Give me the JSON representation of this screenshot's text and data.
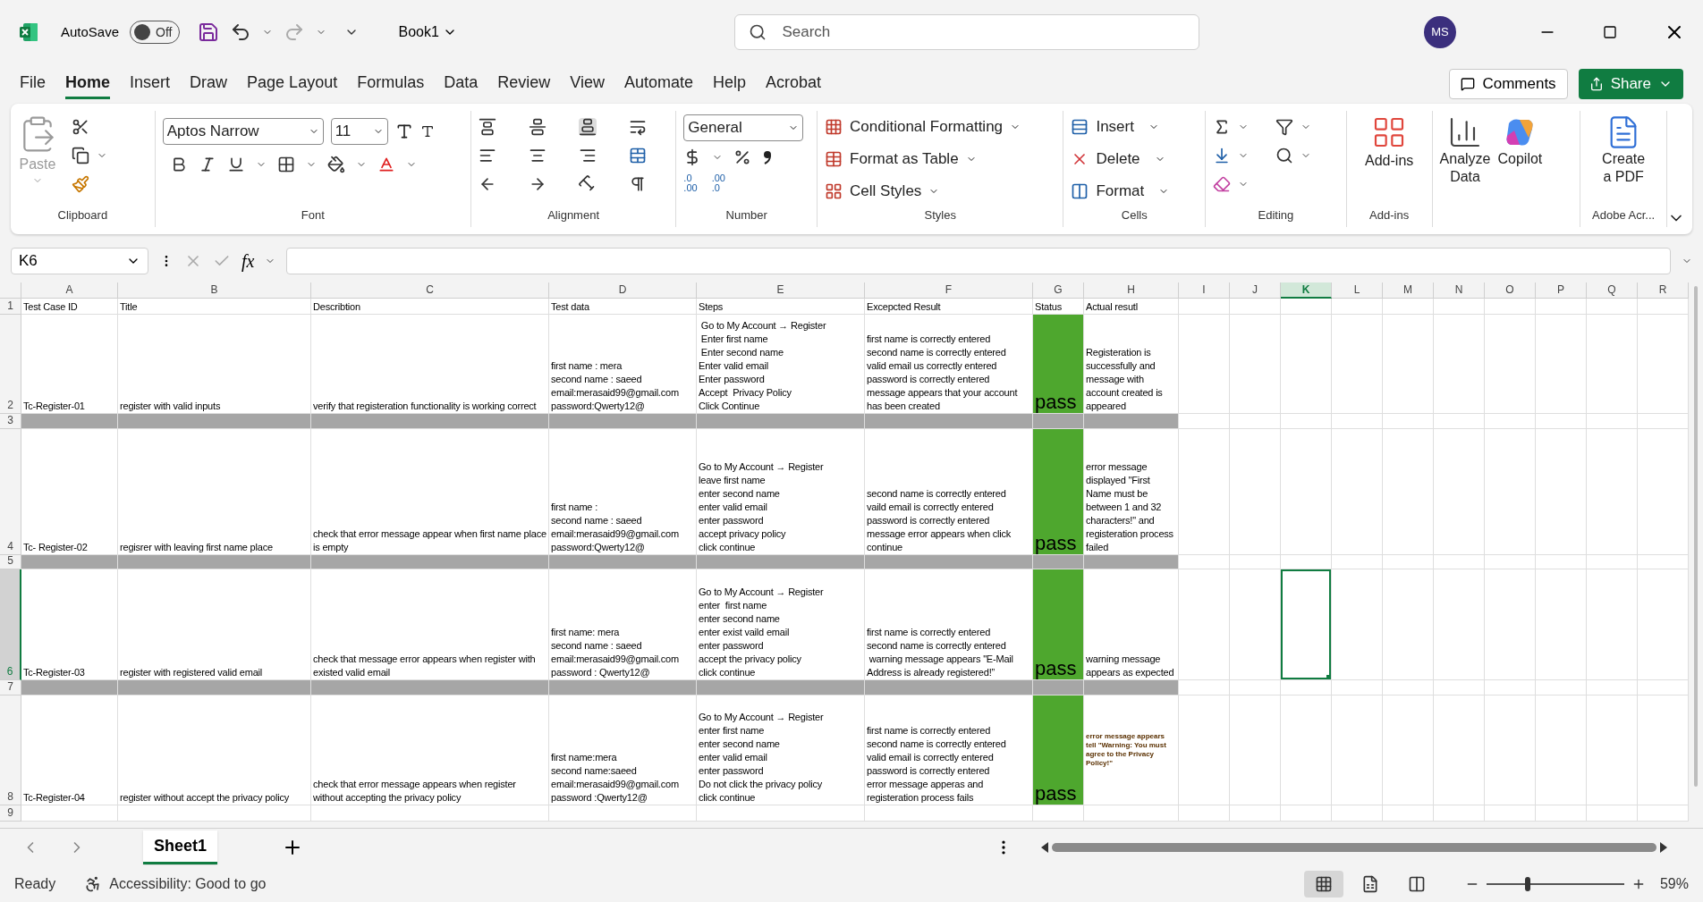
{
  "title_bar": {
    "autosave_label": "AutoSave",
    "autosave": {
      "on": false,
      "label": "Off"
    },
    "document": "Book1",
    "search": {
      "placeholder": "Search"
    },
    "avatar": "MS"
  },
  "menu_tabs": [
    {
      "label": "File",
      "selected": false
    },
    {
      "label": "Home",
      "selected": true
    },
    {
      "label": "Insert",
      "selected": false
    },
    {
      "label": "Draw",
      "selected": false
    },
    {
      "label": "Page Layout",
      "selected": false
    },
    {
      "label": "Formulas",
      "selected": false
    },
    {
      "label": "Data",
      "selected": false
    },
    {
      "label": "Review",
      "selected": false
    },
    {
      "label": "View",
      "selected": false
    },
    {
      "label": "Automate",
      "selected": false
    },
    {
      "label": "Help",
      "selected": false
    },
    {
      "label": "Acrobat",
      "selected": false
    }
  ],
  "comments_button": "Comments",
  "share_button": "Share",
  "ribbon": {
    "clipboard": {
      "paste": {
        "label": "Paste",
        "disabled": true
      },
      "label": "Clipboard"
    },
    "font": {
      "name": "Aptos Narrow",
      "size": "11",
      "label": "Font"
    },
    "alignment": {
      "label": "Alignment"
    },
    "number": {
      "format": "General",
      "decimal_buttons": [
        {
          "top": ".0",
          "bottom": ".00"
        },
        {
          "top": ".00",
          "bottom": ".0"
        }
      ],
      "label": "Number"
    },
    "styles": {
      "buttons": [
        "Conditional Formatting",
        "Format as Table",
        "Cell Styles"
      ],
      "label": "Styles"
    },
    "cells": {
      "buttons": [
        "Insert",
        "Delete",
        "Format"
      ],
      "label": "Cells"
    },
    "editing": {
      "label": "Editing"
    },
    "add_ins": {
      "button": "Add-ins",
      "label": "Add-ins"
    },
    "analyze_data": "Analyze\nData",
    "copilot": "Copilot",
    "adobe": {
      "button": "Create\na PDF",
      "label": "Adobe Acr..."
    }
  },
  "formula_bar": {
    "name_box": "K6",
    "function_label": "fx"
  },
  "columns": [
    {
      "label": "A",
      "selected": false
    },
    {
      "label": "B",
      "selected": false
    },
    {
      "label": "C",
      "selected": false
    },
    {
      "label": "D",
      "selected": false
    },
    {
      "label": "E",
      "selected": false
    },
    {
      "label": "F",
      "selected": false
    },
    {
      "label": "G",
      "selected": false
    },
    {
      "label": "H",
      "selected": false
    },
    {
      "label": "I",
      "selected": false
    },
    {
      "label": "J",
      "selected": false
    },
    {
      "label": "K",
      "selected": true
    },
    {
      "label": "L",
      "selected": false
    },
    {
      "label": "M",
      "selected": false
    },
    {
      "label": "N",
      "selected": false
    },
    {
      "label": "O",
      "selected": false
    },
    {
      "label": "P",
      "selected": false
    },
    {
      "label": "Q",
      "selected": false
    },
    {
      "label": "R",
      "selected": false
    }
  ],
  "rows": [
    {
      "number": "1",
      "kind": "header",
      "selected": false,
      "cells": [
        "Test Case ID",
        "Title",
        "Describtion",
        "Test data",
        "Steps",
        "Excepcted Result",
        "Status",
        "Actual resutl"
      ]
    },
    {
      "number": "2",
      "kind": "case",
      "selected": false,
      "test_case_id": "Tc-Register-01",
      "title": "register with valid inputs",
      "description": "verify that registeration functionality is working correct",
      "test_data": "first name : mera\nsecond name : saeed\nemail:merasaid99@gmail.com\npassword:Qwerty12@",
      "steps": " Go to My Account → Register\n Enter first name\n Enter second name\nEnter valid email\nEnter password\nAccept  Privacy Policy\nClick Continue",
      "expected_result": "first name is correctly entered\nsecond name is correctly entered\nvalid email us correctly entered\npassword is correctly entered\nmessage appears that your account\nhas been created",
      "status": {
        "text": "pass",
        "kind": "pass"
      },
      "actual_result": {
        "text": "Registeration is successfully and message with account created is appeared",
        "kind": "normal"
      }
    },
    {
      "number": "3",
      "kind": "separator",
      "selected": false
    },
    {
      "number": "4",
      "kind": "case",
      "selected": false,
      "test_case_id": "Tc- Register-02",
      "title": "regisrer with leaving first name place",
      "description": "check that error message appear when first name place is empty",
      "test_data": "first name :\nsecond name : saeed\nemail:merasaid99@gmail.com\npassword:Qwerty12@",
      "steps": "Go to My Account → Register\nleave first name\nenter second name\nenter valid email\nenter password\naccept privacy policy\nclick continue",
      "expected_result": "second name is correctly entered\nvaild email is correctly entered\npassword is correctly entered\nmessage error appears when click\ncontinue",
      "status": {
        "text": "pass",
        "kind": "pass"
      },
      "actual_result": {
        "text": "error message displayed \"First Name must be between 1 and 32 characters!\" and registeration process failed",
        "kind": "normal"
      }
    },
    {
      "number": "5",
      "kind": "separator",
      "selected": false
    },
    {
      "number": "6",
      "kind": "case",
      "selected": true,
      "test_case_id": "Tc-Register-03",
      "title": "register with registered valid email",
      "description": "check that message error appears when register with existed valid email",
      "test_data": "first name: mera\nsecond name : saeed\nemail:merasaid99@gmail.com\npassword : Qwerty12@",
      "steps": "Go to My Account → Register\nenter  first name\nenter second name\nenter exist vaild email\nenter password\naccept the privacy policy\nclick continue",
      "expected_result": "first name is correctly entered\nsecond name is correctly entered\n warning message appears \"E-Mail\nAddress is already registered!”",
      "status": {
        "text": "pass",
        "kind": "pass"
      },
      "actual_result": {
        "text": "warning message appears as expected",
        "kind": "normal"
      }
    },
    {
      "number": "7",
      "kind": "separator",
      "selected": false
    },
    {
      "number": "8",
      "kind": "case",
      "selected": false,
      "test_case_id": "Tc-Register-04",
      "title": "register without accept the privacy policy",
      "description": "check that error message appears when register without accepting the privacy policy",
      "test_data": "first name:mera\nsecond name:saeed\nemail:merasaid99@gmail.com\npassword :Qwerty12@",
      "steps": "Go to My Account → Register\nenter first name\nenter second name\nenter valid email\nenter password\nDo not click the privacy policy\nclick continue",
      "expected_result": "first name is correctly entered\nsecond name is correctly entered\nvalid email is correctly entered\npassword is correctly entered\nerror message apperas and\nregisteration process fails",
      "status": {
        "text": "pass",
        "kind": "pass"
      },
      "actual_result": {
        "text": "error message appears tell \"Warning: You must agree to the Privacy Policy!\"",
        "kind": "fine_print"
      }
    },
    {
      "number": "9",
      "kind": "empty",
      "selected": false
    }
  ],
  "sheet_tabs": [
    {
      "label": "Sheet1",
      "selected": true
    }
  ],
  "status_bar": {
    "ready": "Ready",
    "accessibility": "Accessibility: Good to go",
    "views": [
      {
        "kind": "normal",
        "selected": true
      },
      {
        "kind": "page_layout",
        "selected": false
      },
      {
        "kind": "page_break",
        "selected": false
      }
    ],
    "zoom": {
      "level": 0.3,
      "reading": "59%"
    }
  }
}
